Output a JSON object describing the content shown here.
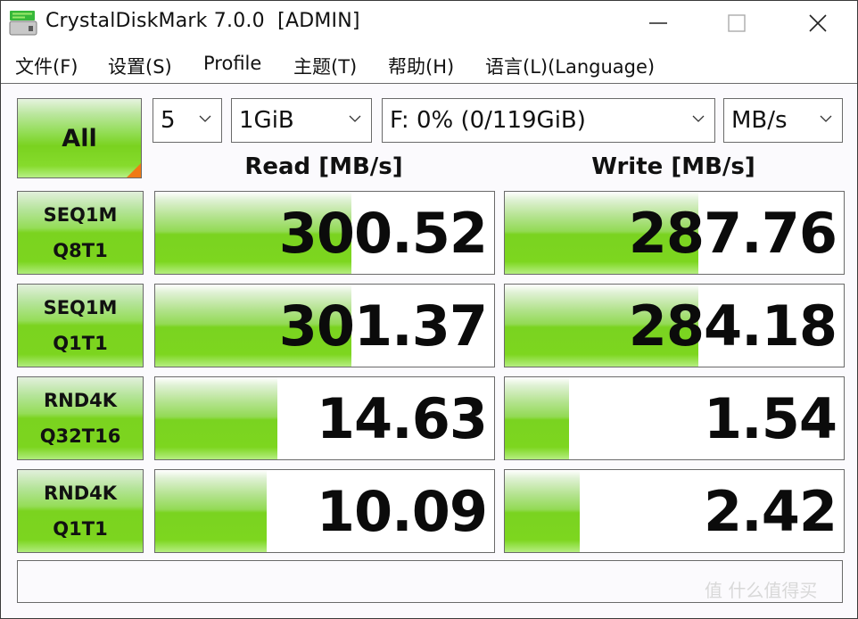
{
  "window": {
    "title": "CrystalDiskMark 7.0.0  [ADMIN]",
    "controls": {
      "minimize": "minimize",
      "maximize": "maximize",
      "close": "close"
    }
  },
  "menu": [
    {
      "label": "文件(F)"
    },
    {
      "label": "设置(S)"
    },
    {
      "label": "Profile"
    },
    {
      "label": "主题(T)"
    },
    {
      "label": "帮助(H)"
    },
    {
      "label": "语言(L)(Language)"
    }
  ],
  "toolbar": {
    "all_button": "All",
    "count_select": "5",
    "size_select": "1GiB",
    "drive_select": "F: 0% (0/119GiB)",
    "unit_select": "MB/s"
  },
  "headers": {
    "read": "Read [MB/s]",
    "write": "Write [MB/s]"
  },
  "tests": [
    {
      "line1": "SEQ1M",
      "line2": "Q8T1",
      "read": "300.52",
      "write": "287.76",
      "read_fill": 0.58,
      "write_fill": 0.57
    },
    {
      "line1": "SEQ1M",
      "line2": "Q1T1",
      "read": "301.37",
      "write": "284.18",
      "read_fill": 0.58,
      "write_fill": 0.57
    },
    {
      "line1": "RND4K",
      "line2": "Q32T16",
      "read": "14.63",
      "write": "1.54",
      "read_fill": 0.36,
      "write_fill": 0.19
    },
    {
      "line1": "RND4K",
      "line2": "Q1T1",
      "read": "10.09",
      "write": "2.42",
      "read_fill": 0.33,
      "write_fill": 0.22
    }
  ],
  "status": "",
  "watermark": "值 什么值得买",
  "colors": {
    "bar_green": "#7ad320",
    "all_corner": "#f07a14",
    "border": "#6a6a6a"
  }
}
